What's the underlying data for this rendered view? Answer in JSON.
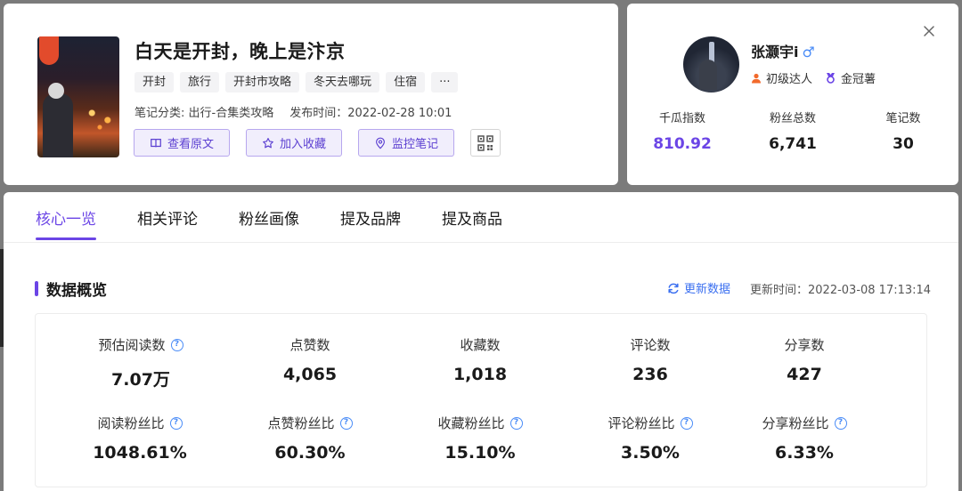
{
  "note": {
    "title": "白天是开封，晚上是汴京",
    "tags": [
      "开封",
      "旅行",
      "开封市攻略",
      "冬天去哪玩",
      "住宿",
      "···"
    ],
    "category_label": "笔记分类: 出行-合集类攻略",
    "publish_label": "发布时间：2022-02-28 10:01",
    "actions": {
      "view_original": "查看原文",
      "add_favorite": "加入收藏",
      "monitor_note": "监控笔记"
    }
  },
  "author": {
    "name": "张灏宇i",
    "gender_symbol": "♂",
    "level_badge": "初级达人",
    "crown_badge": "金冠薯",
    "stats": [
      {
        "label": "千瓜指数",
        "value": "810.92"
      },
      {
        "label": "粉丝总数",
        "value": "6,741"
      },
      {
        "label": "笔记数",
        "value": "30"
      }
    ]
  },
  "tabs": [
    "核心一览",
    "相关评论",
    "粉丝画像",
    "提及品牌",
    "提及商品"
  ],
  "overview": {
    "title": "数据概览",
    "refresh_label": "更新数据",
    "updated_label": "更新时间：2022-03-08 17:13:14",
    "metrics": [
      {
        "label": "预估阅读数",
        "value": "7.07万",
        "help": true
      },
      {
        "label": "点赞数",
        "value": "4,065",
        "help": false
      },
      {
        "label": "收藏数",
        "value": "1,018",
        "help": false
      },
      {
        "label": "评论数",
        "value": "236",
        "help": false
      },
      {
        "label": "分享数",
        "value": "427",
        "help": false
      }
    ],
    "ratios": [
      {
        "label": "阅读粉丝比",
        "value": "1048.61%"
      },
      {
        "label": "点赞粉丝比",
        "value": "60.30%"
      },
      {
        "label": "收藏粉丝比",
        "value": "15.10%"
      },
      {
        "label": "评论粉丝比",
        "value": "3.50%"
      },
      {
        "label": "分享粉丝比",
        "value": "6.33%"
      }
    ]
  },
  "colors": {
    "accent": "#6b45e6",
    "link": "#3a6ff0",
    "help": "#4a8cf7"
  }
}
